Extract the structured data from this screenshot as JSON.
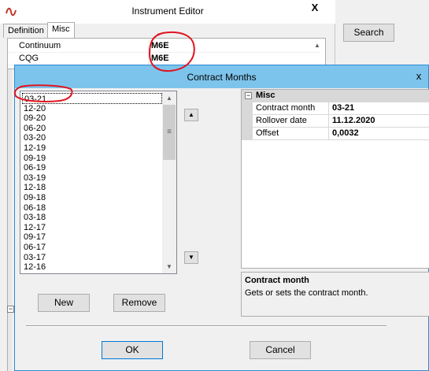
{
  "instrument_editor": {
    "title": "Instrument Editor",
    "close_glyph": "X",
    "tabs": [
      {
        "label": "Definition",
        "active": false
      },
      {
        "label": "Misc",
        "active": true
      }
    ],
    "rows": [
      {
        "label": "Continuum",
        "value": "M6E"
      },
      {
        "label": "CQG",
        "value": "M6E"
      }
    ],
    "collapse_glyph": "⊟"
  },
  "search": {
    "label": "Search"
  },
  "contract_months": {
    "title": "Contract Months",
    "close_glyph": "x",
    "months": [
      "03-21",
      "12-20",
      "09-20",
      "06-20",
      "03-20",
      "12-19",
      "09-19",
      "06-19",
      "03-19",
      "12-18",
      "09-18",
      "06-18",
      "03-18",
      "12-17",
      "09-17",
      "06-17",
      "03-17",
      "12-16"
    ],
    "selected_month": "03-21",
    "buttons": {
      "new": "New",
      "remove": "Remove",
      "ok": "OK",
      "cancel": "Cancel"
    },
    "properties": {
      "category": "Misc",
      "collapse_glyph": "⊟",
      "rows": [
        {
          "name": "Contract month",
          "value": "03-21"
        },
        {
          "name": "Rollover date",
          "value": "11.12.2020"
        },
        {
          "name": "Offset",
          "value": "0,0032"
        }
      ]
    },
    "help": {
      "title": "Contract month",
      "text": "Gets or sets the contract month."
    }
  },
  "icons": {
    "move_up": "▲",
    "move_down": "▼",
    "scroll_up": "▲",
    "scroll_down": "▼",
    "scroll_grip": "≡"
  },
  "colors": {
    "dialog_titlebar": "#7dc4ec",
    "dialog_border": "#2a8dd4",
    "annotation": "#e0141e"
  }
}
